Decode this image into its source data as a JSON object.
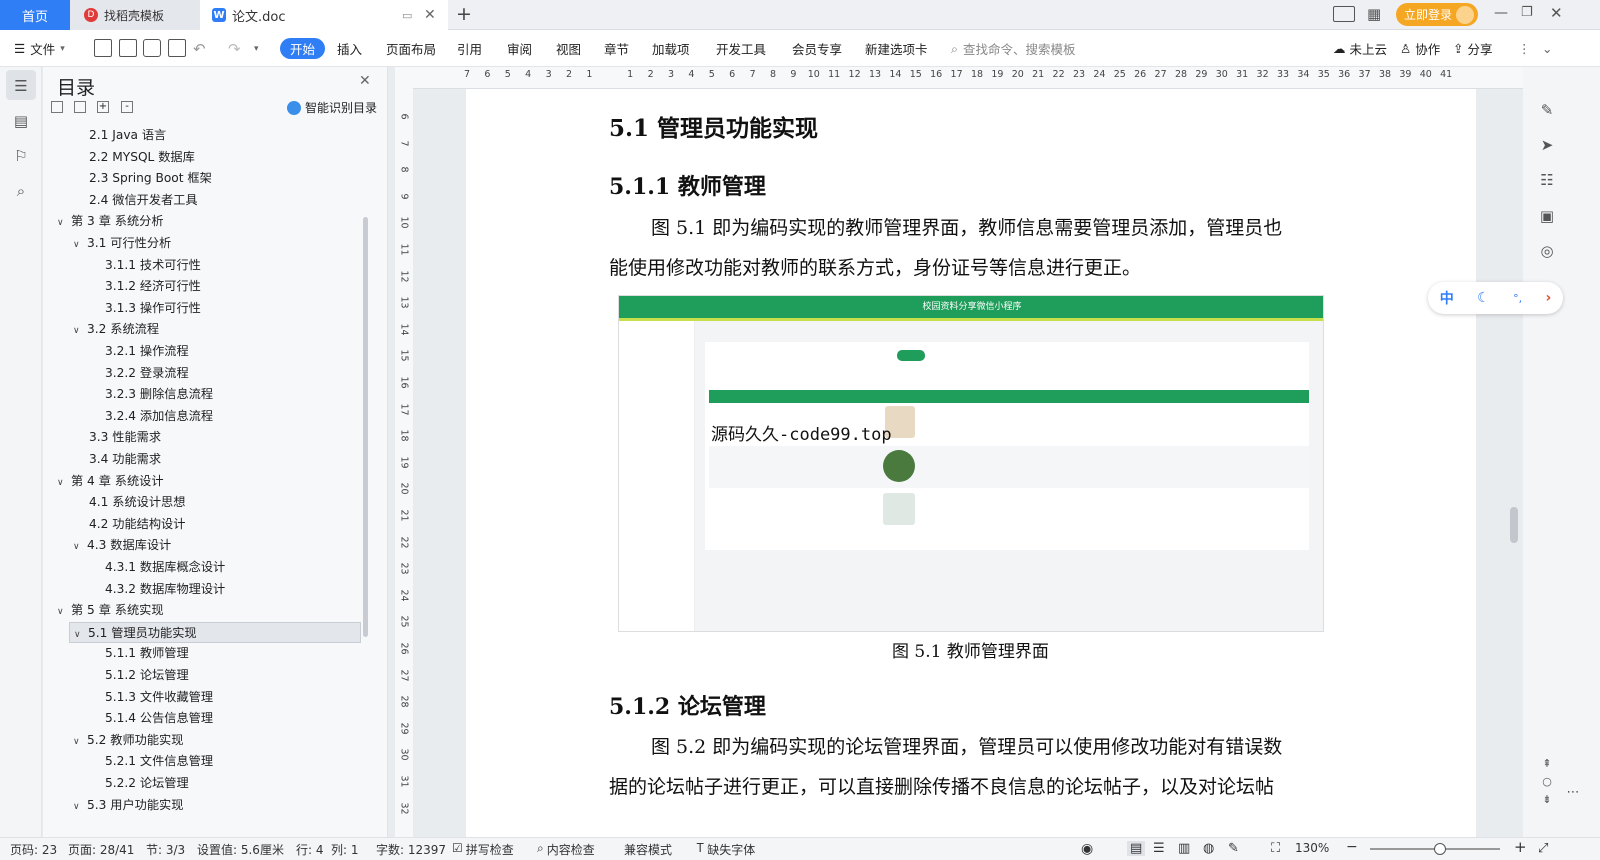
{
  "tabs": {
    "home": "首页",
    "template": "找稻壳模板",
    "document": "论文.doc",
    "login": "立即登录"
  },
  "ribbon": {
    "file": "文件",
    "items": [
      "开始",
      "插入",
      "页面布局",
      "引用",
      "审阅",
      "视图",
      "章节",
      "加载项",
      "开发工具",
      "会员专享",
      "新建选项卡"
    ],
    "search_placeholder": "查找命令、搜索模板",
    "cloud": "未上云",
    "collab": "协作",
    "share": "分享"
  },
  "toc": {
    "title": "目录",
    "smart": "智能识别目录",
    "items": [
      {
        "text": "2.1 Java 语言",
        "level": 2
      },
      {
        "text": "2.2 MYSQL 数据库",
        "level": 2
      },
      {
        "text": "2.3 Spring Boot 框架",
        "level": 2
      },
      {
        "text": "2.4 微信开发者工具",
        "level": 2
      },
      {
        "text": "第 3 章  系统分析",
        "level": 1
      },
      {
        "text": "3.1  可行性分析",
        "level": 2
      },
      {
        "text": "3.1.1  技术可行性",
        "level": 3
      },
      {
        "text": "3.1.2  经济可行性",
        "level": 3
      },
      {
        "text": "3.1.3  操作可行性",
        "level": 3
      },
      {
        "text": "3.2  系统流程",
        "level": 2
      },
      {
        "text": "3.2.1  操作流程",
        "level": 3
      },
      {
        "text": "3.2.2  登录流程",
        "level": 3
      },
      {
        "text": "3.2.3  删除信息流程",
        "level": 3
      },
      {
        "text": "3.2.4  添加信息流程",
        "level": 3
      },
      {
        "text": "3.3  性能需求",
        "level": 2
      },
      {
        "text": "3.4  功能需求",
        "level": 2
      },
      {
        "text": "第 4 章  系统设计",
        "level": 1
      },
      {
        "text": "4.1  系统设计思想",
        "level": 2
      },
      {
        "text": "4.2  功能结构设计",
        "level": 2
      },
      {
        "text": "4.3  数据库设计",
        "level": 2
      },
      {
        "text": "4.3.1  数据库概念设计",
        "level": 3
      },
      {
        "text": "4.3.2  数据库物理设计",
        "level": 3
      },
      {
        "text": "第 5 章  系统实现",
        "level": 1
      },
      {
        "text": "5.1  管理员功能实现",
        "level": 2
      },
      {
        "text": "5.1.1  教师管理",
        "level": 3
      },
      {
        "text": "5.1.2  论坛管理",
        "level": 3
      },
      {
        "text": "5.1.3  文件收藏管理",
        "level": 3
      },
      {
        "text": "5.1.4  公告信息管理",
        "level": 3
      },
      {
        "text": "5.2  教师功能实现",
        "level": 2
      },
      {
        "text": "5.2.1  文件信息管理",
        "level": 3
      },
      {
        "text": "5.2.2  论坛管理",
        "level": 3
      },
      {
        "text": "5.3  用户功能实现",
        "level": 2
      }
    ]
  },
  "doc": {
    "h51": "5.1  管理员功能实现",
    "h511": "5.1.1  教师管理",
    "p1_line1": "图 5.1  即为编码实现的教师管理界面，教师信息需要管理员添加，管理员也",
    "p1_line2": "能使用修改功能对教师的联系方式，身份证号等信息进行更正。",
    "fig_caption": "图 5.1  教师管理界面",
    "h512": "5.1.2  论坛管理",
    "p2_line1": "图 5.2  即为编码实现的论坛管理界面，管理员可以使用修改功能对有错误数",
    "p2_line2": "据的论坛帖子进行更正，可以直接删除传播不良信息的论坛帖子，以及对论坛帖",
    "watermark": "源码久久-code99.top",
    "shot_title": "校园资料分享微信小程序"
  },
  "status": {
    "pages_num": "页码: 23",
    "page": "页面: 28/41",
    "section": "节: 3/3",
    "setting": "设置值: 5.6厘米",
    "row": "行: 4",
    "col": "列: 1",
    "words": "字数: 12397",
    "spell": "拼写检查",
    "content": "内容检查",
    "compat": "兼容模式",
    "missing_font": "缺失字体",
    "zoom": "130%"
  },
  "float_bar": {
    "cn": "中"
  },
  "ruler": {
    "h": [
      "7",
      "6",
      "5",
      "4",
      "3",
      "2",
      "1",
      "",
      "1",
      "2",
      "3",
      "4",
      "5",
      "6",
      "7",
      "8",
      "9",
      "10",
      "11",
      "12",
      "13",
      "14",
      "15",
      "16",
      "17",
      "18",
      "19",
      "20",
      "21",
      "22",
      "23",
      "24",
      "25",
      "26",
      "27",
      "28",
      "29",
      "30",
      "31",
      "32",
      "33",
      "34",
      "35",
      "36",
      "37",
      "38",
      "39",
      "40",
      "41"
    ],
    "v": [
      "6",
      "7",
      "8",
      "9",
      "10",
      "11",
      "12",
      "13",
      "14",
      "15",
      "16",
      "17",
      "18",
      "19",
      "20",
      "21",
      "22",
      "23",
      "24",
      "25",
      "26",
      "27",
      "28",
      "29",
      "30",
      "31",
      "32"
    ]
  }
}
